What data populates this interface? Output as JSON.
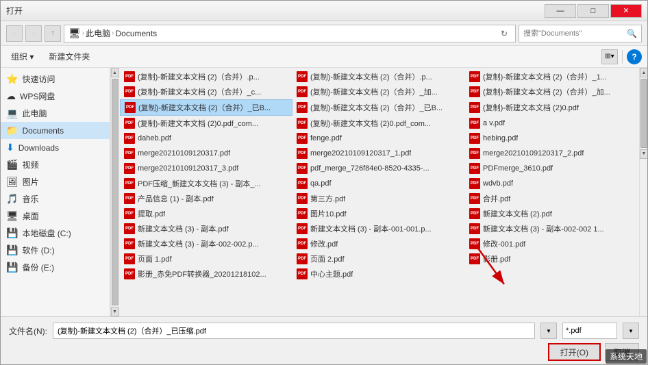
{
  "dialog": {
    "title": "打开",
    "address": {
      "parts": [
        "此电脑",
        "Documents"
      ],
      "separator": "›",
      "refresh_icon": "↻",
      "search_placeholder": "搜索\"Documents\""
    },
    "toolbar2": {
      "organize_label": "组织 ▾",
      "new_folder_label": "新建文件夹"
    },
    "sidebar": {
      "items": [
        {
          "id": "quick-access",
          "icon": "⭐",
          "label": "快速访问"
        },
        {
          "id": "wps-cloud",
          "icon": "☁",
          "label": "WPS网盘"
        },
        {
          "id": "this-pc",
          "icon": "💻",
          "label": "此电脑"
        },
        {
          "id": "documents",
          "icon": "📄",
          "label": "Documents",
          "selected": true
        },
        {
          "id": "downloads",
          "icon": "⬇",
          "label": "Downloads"
        },
        {
          "id": "videos",
          "icon": "🎬",
          "label": "视频"
        },
        {
          "id": "pictures",
          "icon": "🖼",
          "label": "图片"
        },
        {
          "id": "music",
          "icon": "🎵",
          "label": "音乐"
        },
        {
          "id": "desktop",
          "icon": "🖥",
          "label": "桌面"
        },
        {
          "id": "local-disk-c",
          "icon": "💾",
          "label": "本地磁盘 (C:)"
        },
        {
          "id": "software-d",
          "icon": "💾",
          "label": "软件 (D:)"
        },
        {
          "id": "backup-e",
          "icon": "💾",
          "label": "备份 (E:)"
        }
      ]
    },
    "files": [
      {
        "name": "(复制)-新建文本文档 (2)（合并）.p..."
      },
      {
        "name": "(复制)-新建文本文档 (2)（合并）.p..."
      },
      {
        "name": "(复制)-新建文本文档 (2)（合并）_1..."
      },
      {
        "name": "(复制)-新建文本文档 (2)（合并）_c..."
      },
      {
        "name": "(复制)-新建文本文档 (2)（合并）_加..."
      },
      {
        "name": "(复制)-新建文本文档 (2)（合并）_加..."
      },
      {
        "name": "(复制)-新建文本文档 (2)（合并）_已B...",
        "selected": true
      },
      {
        "name": "(复制)-新建文本文档 (2)（合并）_已B..."
      },
      {
        "name": "(复制)-新建文本文档 (2)0.pdf"
      },
      {
        "name": "(复制)-新建文本文档 (2)0.pdf_com..."
      },
      {
        "name": "(复制)-新建文本文档 (2)0.pdf_com..."
      },
      {
        "name": "a v.pdf"
      },
      {
        "name": "daheb.pdf"
      },
      {
        "name": "fenge.pdf"
      },
      {
        "name": "hebing.pdf"
      },
      {
        "name": "merge20210109120317.pdf"
      },
      {
        "name": "merge20210109120317_1.pdf"
      },
      {
        "name": "merge20210109120317_2.pdf"
      },
      {
        "name": "merge20210109120317_3.pdf"
      },
      {
        "name": "pdf_merge_726f84e0-8520-4335-..."
      },
      {
        "name": "PDFmerge_3610.pdf"
      },
      {
        "name": "PDF压缩_新建文本文档 (3) - 副本_..."
      },
      {
        "name": "qa.pdf"
      },
      {
        "name": "wdvb.pdf"
      },
      {
        "name": "产品信息 (1) - 副本.pdf"
      },
      {
        "name": "第三方.pdf"
      },
      {
        "name": "合并.pdf"
      },
      {
        "name": "提取.pdf"
      },
      {
        "name": "图片10.pdf"
      },
      {
        "name": "新建文本文档 (2).pdf"
      },
      {
        "name": "新建文本文档 (3) - 副本.pdf"
      },
      {
        "name": "新建文本文档 (3) - 副本-001-001.p..."
      },
      {
        "name": "新建文本文档 (3) - 副本-002-002 1..."
      },
      {
        "name": "新建文本文档 (3) - 副本-002-002.p..."
      },
      {
        "name": "修改.pdf"
      },
      {
        "name": "修改-001.pdf"
      },
      {
        "name": "页面 1.pdf"
      },
      {
        "name": "页面 2.pdf"
      },
      {
        "name": "影册.pdf"
      },
      {
        "name": "影册_赤免PDF转换器_20201218102..."
      },
      {
        "name": "中心主题.pdf"
      }
    ],
    "filename_label": "文件名(N):",
    "filename_value": "(复制)-新建文本文档 (2)（合并）_已压缩.pdf",
    "filetype_value": "*.pdf",
    "open_button": "打开(O)",
    "cancel_button": "取消",
    "watermark": "系统天地"
  }
}
